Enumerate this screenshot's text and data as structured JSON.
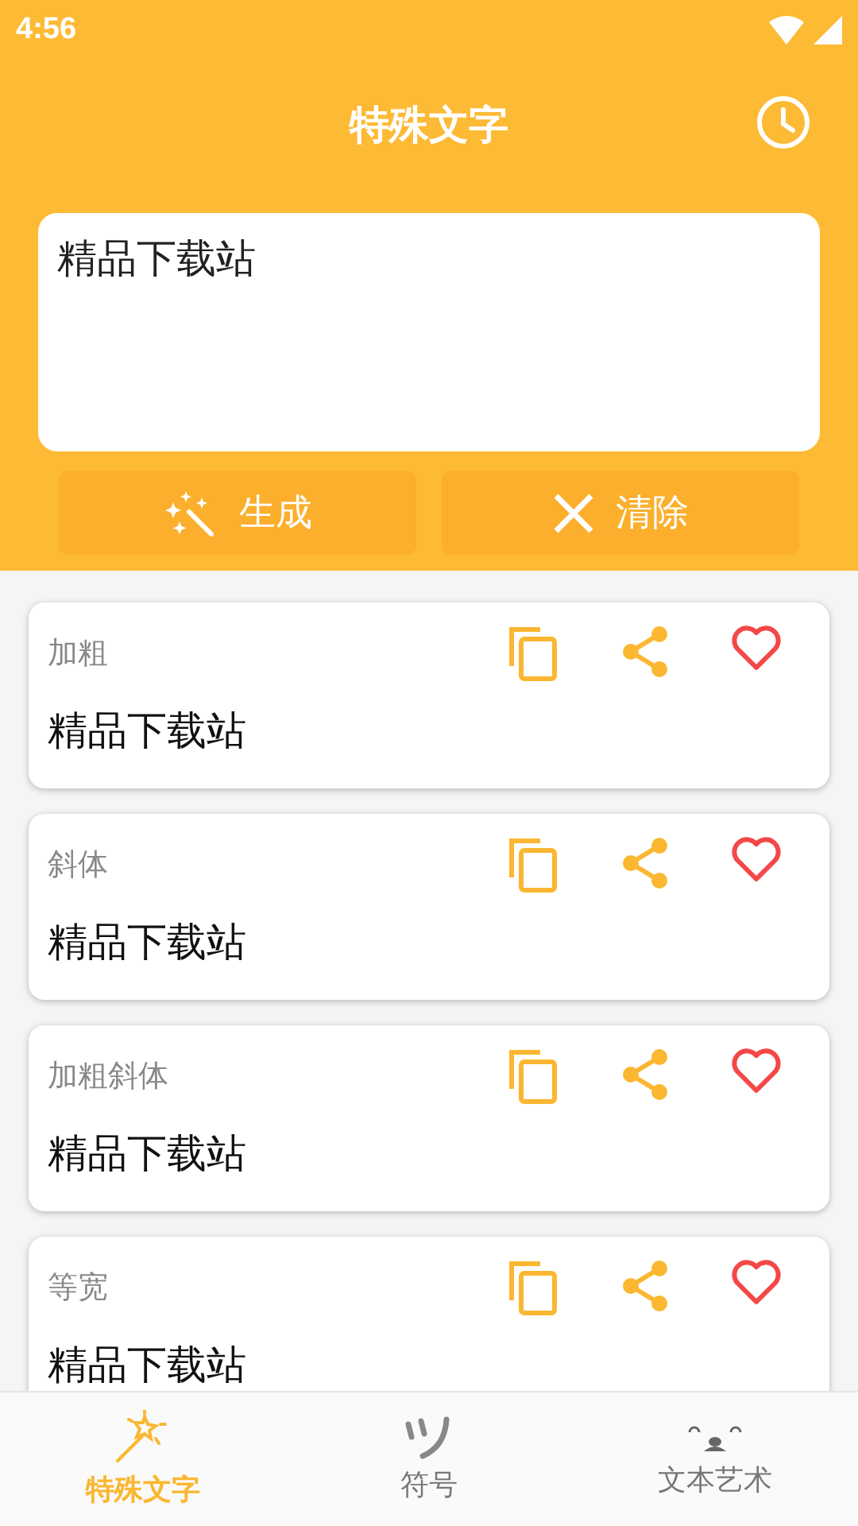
{
  "status_bar": {
    "time": "4:56"
  },
  "app_bar": {
    "title": "特殊文字"
  },
  "input": {
    "value": "精品下载站"
  },
  "actions": [
    {
      "kind": "generate",
      "label": "生成"
    },
    {
      "kind": "clear",
      "label": "清除"
    }
  ],
  "results": [
    {
      "style": "加粗",
      "text": "精品下载站",
      "favorited": false
    },
    {
      "style": "斜体",
      "text": "精品下载站",
      "favorited": false
    },
    {
      "style": "加粗斜体",
      "text": "精品下载站",
      "favorited": false
    },
    {
      "style": "等宽",
      "text": "精品下载站",
      "favorited": false
    }
  ],
  "bottom_nav": [
    {
      "kind": "wand",
      "label": "特殊文字",
      "selected": true
    },
    {
      "kind": "symbol",
      "label": "符号",
      "selected": false
    },
    {
      "kind": "face",
      "label": "文本艺术",
      "selected": false
    }
  ]
}
